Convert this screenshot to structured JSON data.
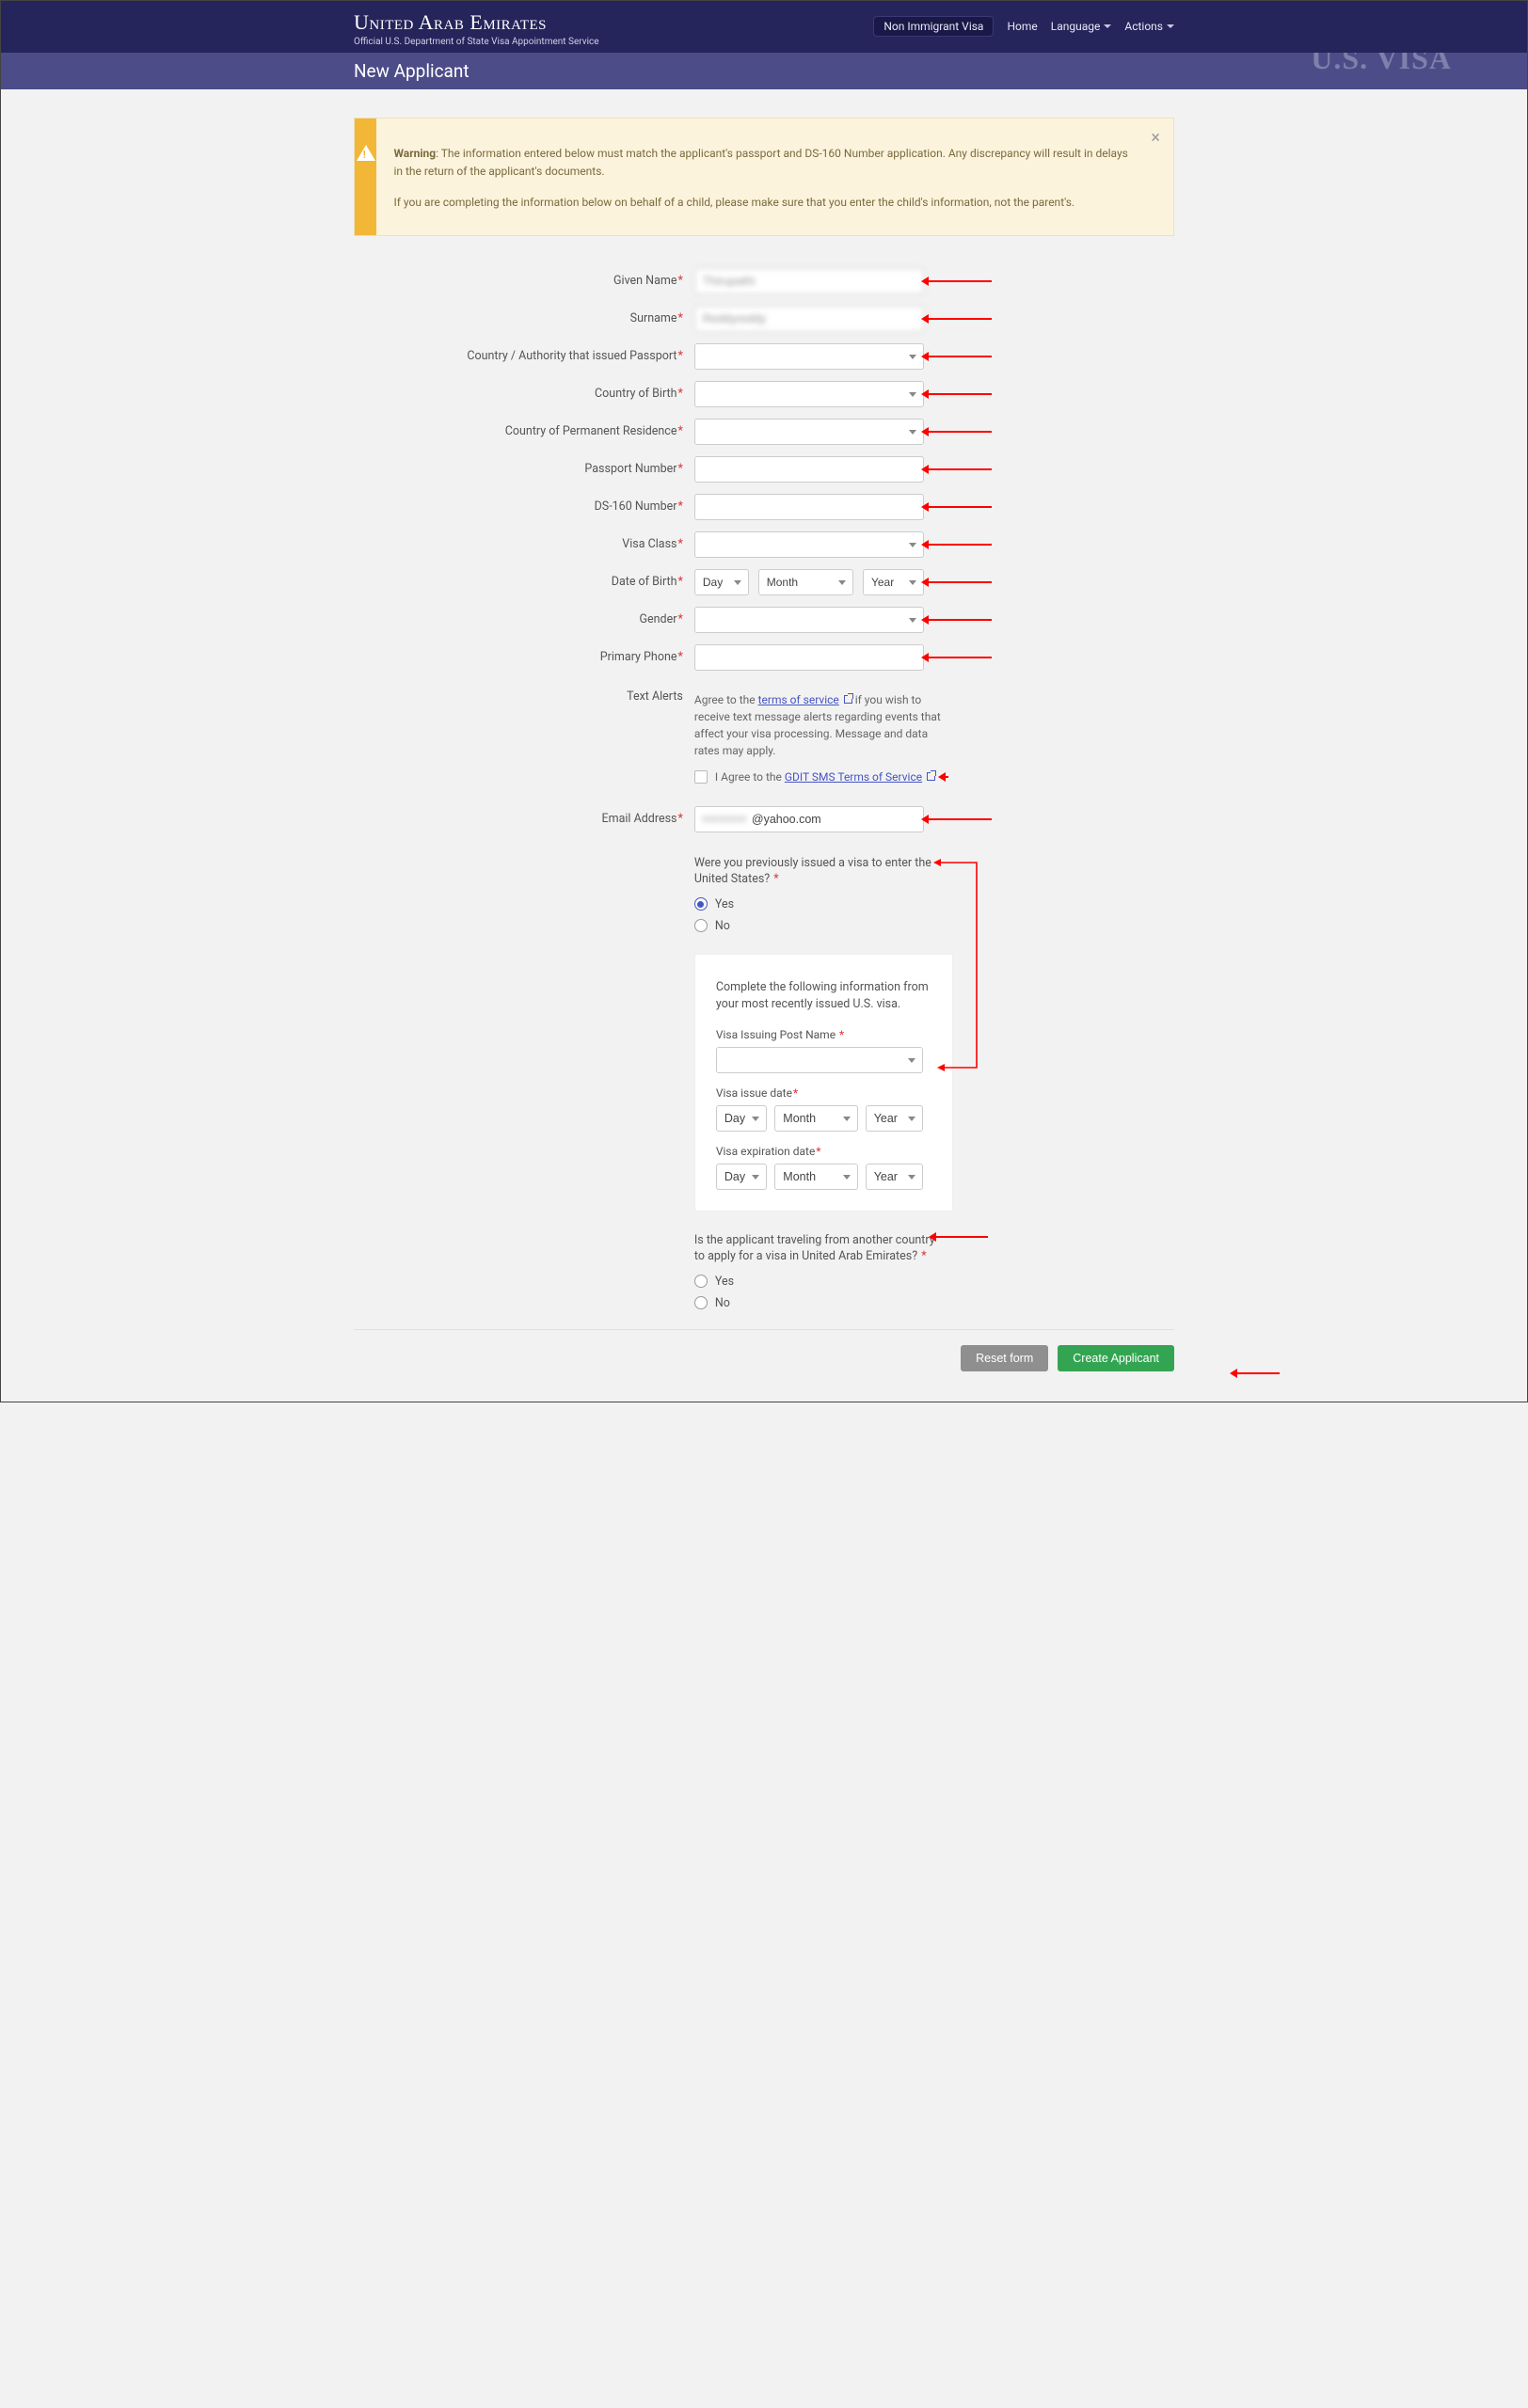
{
  "navbar": {
    "title": "United Arab Emirates",
    "subtitle": "Official U.S. Department of State Visa Appointment Service",
    "pill": "Non Immigrant Visa",
    "home": "Home",
    "language": "Language",
    "actions": "Actions"
  },
  "subheader": {
    "title": "New Applicant",
    "bg": "U.S. VISA"
  },
  "alert": {
    "lead": "Warning",
    "p1": ": The information entered below must match the applicant's passport and DS-160 Number application. Any discrepancy will result in delays in the return of the applicant's documents.",
    "p2": "If you are completing the information below on behalf of a child, please make sure that you enter the child's information, not the parent's."
  },
  "labels": {
    "given_name": "Given Name",
    "surname": "Surname",
    "country_passport": "Country / Authority that issued Passport",
    "country_birth": "Country of Birth",
    "country_residence": "Country of Permanent Residence",
    "passport_number": "Passport Number",
    "ds160": "DS-160 Number",
    "visa_class": "Visa Class",
    "dob": "Date of Birth",
    "gender": "Gender",
    "primary_phone": "Primary Phone",
    "text_alerts": "Text Alerts",
    "email": "Email Address"
  },
  "text_alerts": {
    "pre": "Agree to the ",
    "tos_link": "terms of service",
    "post": " if you wish to receive text message alerts regarding events that affect your visa processing. Message and data rates may apply.",
    "agree_pre": "I Agree to the ",
    "agree_link": "GDIT SMS Terms of Service"
  },
  "date": {
    "day": "Day",
    "month": "Month",
    "year": "Year"
  },
  "values": {
    "given_name": "Thirupathi",
    "surname": "Reddyreddy",
    "email": "@yahoo.com"
  },
  "q1": {
    "text": "Were you previously issued a visa to enter the United States? ",
    "yes": "Yes",
    "no": "No"
  },
  "inset": {
    "desc": "Complete the following information from your most recently issued U.S. visa.",
    "post_label": "Visa Issuing Post Name ",
    "issue_label": "Visa issue date",
    "exp_label": "Visa expiration date"
  },
  "q2": {
    "text": "Is the applicant traveling from another country to apply for a visa in United Arab Emirates? ",
    "yes": "Yes",
    "no": "No"
  },
  "buttons": {
    "reset": "Reset form",
    "create": "Create Applicant"
  }
}
